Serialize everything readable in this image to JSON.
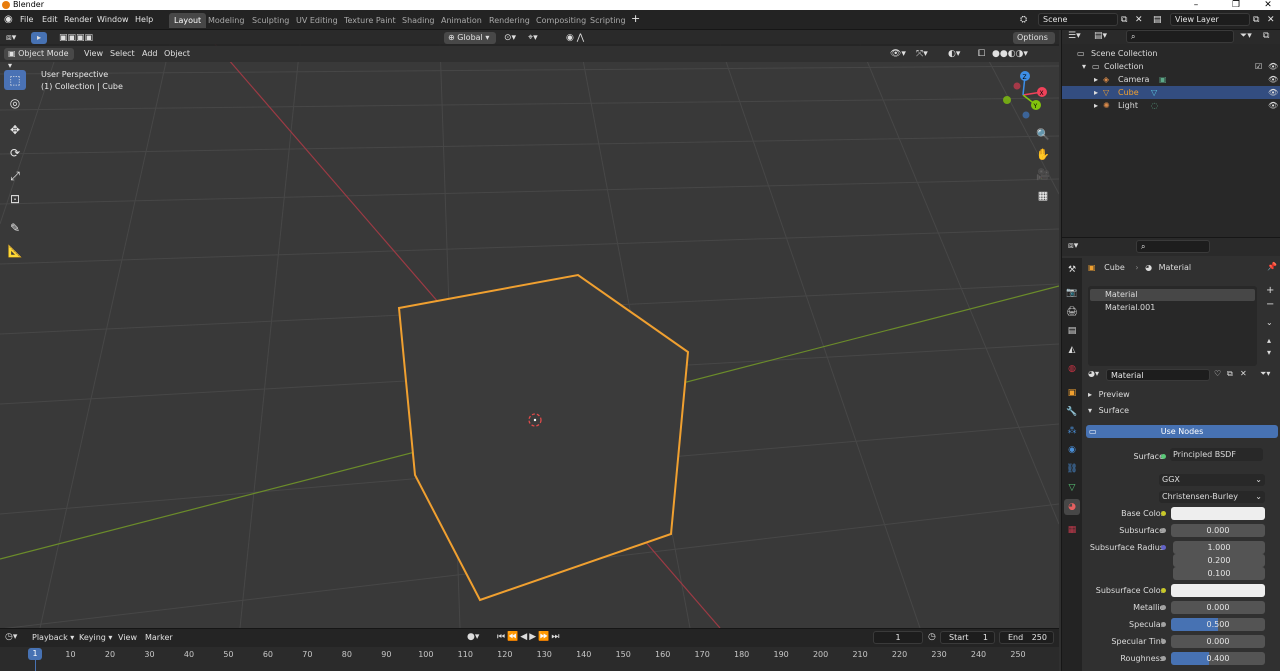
{
  "window": {
    "title": "Blender"
  },
  "menu": [
    "File",
    "Edit",
    "Render",
    "Window",
    "Help"
  ],
  "workspaces": [
    "Layout",
    "Modeling",
    "Sculpting",
    "UV Editing",
    "Texture Paint",
    "Shading",
    "Animation",
    "Rendering",
    "Compositing",
    "Scripting"
  ],
  "scene": {
    "name": "Scene",
    "view_layer": "View Layer"
  },
  "viewport": {
    "mode": "Object Mode",
    "menus": [
      "View",
      "Select",
      "Add",
      "Object"
    ],
    "transform_orientation": "Global",
    "options_label": "Options",
    "info_line1": "User Perspective",
    "info_line2": "(1) Collection | Cube",
    "gizmo": {
      "x": "X",
      "y": "Y",
      "z": "Z"
    }
  },
  "outliner": {
    "root": "Scene Collection",
    "collection": "Collection",
    "items": [
      {
        "name": "Camera",
        "selected": false
      },
      {
        "name": "Cube",
        "selected": true
      },
      {
        "name": "Light",
        "selected": false
      }
    ]
  },
  "properties": {
    "breadcrumb_object": "Cube",
    "breadcrumb_material": "Material",
    "slots": [
      "Material",
      "Material.001"
    ],
    "material_name": "Material",
    "panels": {
      "preview": "Preview",
      "surface": "Surface"
    },
    "use_nodes": "Use Nodes",
    "surface_label": "Surface",
    "surface_value": "Principled BSDF",
    "distribution": "GGX",
    "subsurface_method": "Christensen-Burley",
    "fields": {
      "base_color": "Base Color",
      "subsurface": {
        "label": "Subsurface",
        "value": "0.000"
      },
      "subsurface_radius": {
        "label": "Subsurface Radius",
        "values": [
          "1.000",
          "0.200",
          "0.100"
        ]
      },
      "subsurface_color": "Subsurface Color",
      "metallic": {
        "label": "Metallic",
        "value": "0.000"
      },
      "specular": {
        "label": "Specular",
        "value": "0.500",
        "fraction": 0.5
      },
      "specular_tint": {
        "label": "Specular Tint",
        "value": "0.000"
      },
      "roughness": {
        "label": "Roughness",
        "value": "0.400",
        "fraction": 0.4
      }
    }
  },
  "timeline": {
    "menus": [
      "Playback",
      "Keying",
      "View",
      "Marker"
    ],
    "current_frame": "1",
    "start_label": "Start",
    "start": "1",
    "end_label": "End",
    "end": "250",
    "ticks": [
      "1",
      "10",
      "20",
      "30",
      "40",
      "50",
      "60",
      "70",
      "80",
      "90",
      "100",
      "110",
      "120",
      "130",
      "140",
      "150",
      "160",
      "170",
      "180",
      "190",
      "200",
      "210",
      "220",
      "230",
      "240",
      "250"
    ]
  },
  "colors": {
    "accent": "#4772b3",
    "selection": "#f0a030",
    "x_axis": "#9c3a44",
    "y_axis": "#6b8c2a",
    "gizmo_x": "#f0425a",
    "gizmo_y": "#82c40d",
    "gizmo_z": "#3d8ee6"
  }
}
